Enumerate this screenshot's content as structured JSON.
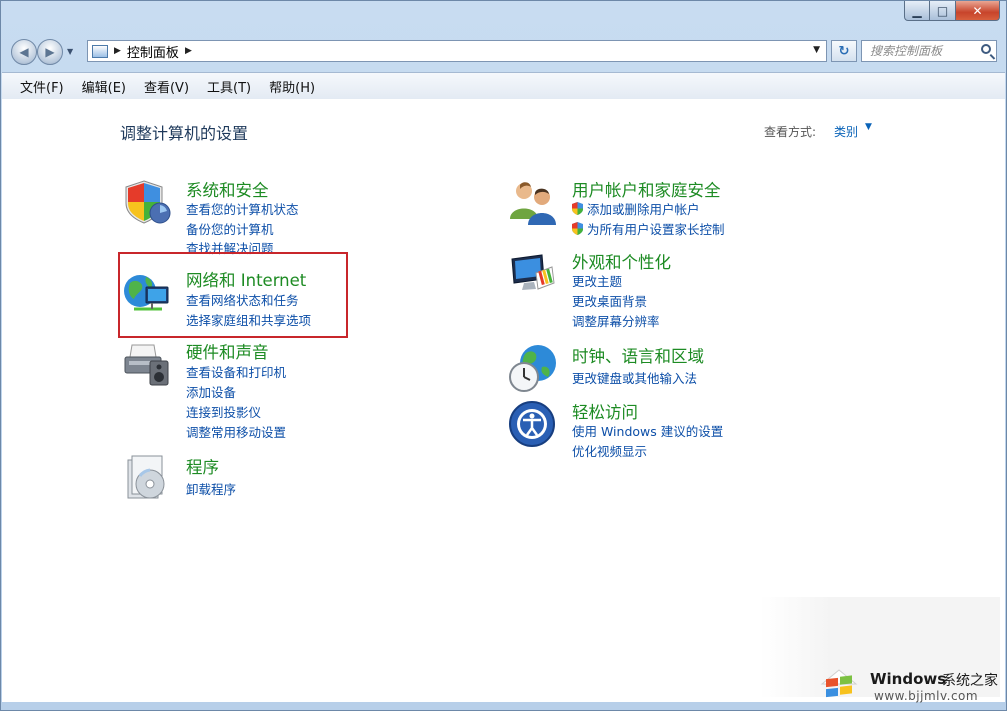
{
  "titlebar": {
    "minimize": "▁",
    "maximize": "□",
    "close": "✕"
  },
  "nav": {
    "back": "◀",
    "forward": "▶",
    "breadcrumb": [
      "控制面板"
    ],
    "search_placeholder": "搜索控制面板"
  },
  "menu": [
    "文件(F)",
    "编辑(E)",
    "查看(V)",
    "工具(T)",
    "帮助(H)"
  ],
  "page": {
    "title": "调整计算机的设置",
    "view_by_label": "查看方式:",
    "view_by_value": "类别"
  },
  "categories": [
    {
      "title": "系统和安全",
      "icon": "shield-icon",
      "links": [
        "查看您的计算机状态",
        "备份您的计算机",
        "查找并解决问题"
      ]
    },
    {
      "title": "网络和 Internet",
      "icon": "network-icon",
      "links": [
        "查看网络状态和任务",
        "选择家庭组和共享选项"
      ]
    },
    {
      "title": "硬件和声音",
      "icon": "printer-icon",
      "links": [
        "查看设备和打印机",
        "添加设备",
        "连接到投影仪",
        "调整常用移动设置"
      ]
    },
    {
      "title": "程序",
      "icon": "programs-icon",
      "links": [
        "卸载程序"
      ]
    },
    {
      "title": "用户帐户和家庭安全",
      "icon": "users-icon",
      "links": [
        "添加或删除用户帐户",
        "为所有用户设置家长控制"
      ]
    },
    {
      "title": "外观和个性化",
      "icon": "appearance-icon",
      "links": [
        "更改主题",
        "更改桌面背景",
        "调整屏幕分辨率"
      ]
    },
    {
      "title": "时钟、语言和区域",
      "icon": "clock-globe-icon",
      "links": [
        "更改键盘或其他输入法"
      ]
    },
    {
      "title": "轻松访问",
      "icon": "ease-of-access-icon",
      "links": [
        "使用 Windows 建议的设置",
        "优化视频显示"
      ]
    }
  ],
  "watermark": {
    "brand": "Windows",
    "site": "系统之家",
    "url": "www.bjjmlv.com"
  },
  "colors": {
    "category_title": "#1d8b23",
    "link": "#0d4fa8",
    "highlight_box": "#c8262b"
  }
}
